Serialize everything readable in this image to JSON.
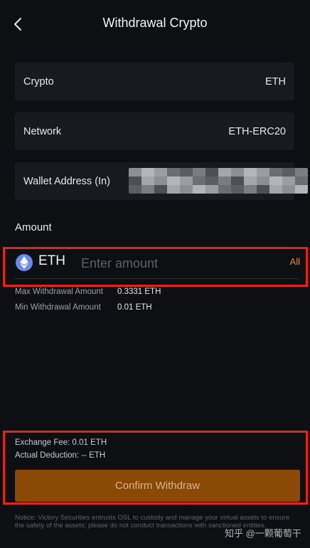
{
  "header": {
    "title": "Withdrawal Crypto"
  },
  "fields": {
    "crypto": {
      "label": "Crypto",
      "value": "ETH"
    },
    "network": {
      "label": "Network",
      "value": "ETH-ERC20"
    },
    "wallet": {
      "label": "Wallet Address (In)"
    }
  },
  "amount": {
    "section_title": "Amount",
    "currency": "ETH",
    "placeholder": "Enter amount",
    "all_label": "All"
  },
  "limits": {
    "max_label": "Max Withdrawal Amount",
    "max_value": "0.3331 ETH",
    "min_label": "Min Withdrawal Amount",
    "min_value": "0.01 ETH"
  },
  "fees": {
    "exchange_fee": "Exchange Fee: 0.01 ETH",
    "actual_deduction": "Actual Deduction: -- ETH"
  },
  "confirm_label": "Confirm Withdraw",
  "notice": "Notice: Victory Securities entrusts OSL to custody and manage your virtual assets to ensure the safety of the assets; please do not conduct transactions with sanctioned entities.",
  "watermark": "知乎 @一颗葡萄干",
  "colors": {
    "accent": "#ef8a1e",
    "confirm_bg": "#8a4a05",
    "highlight": "#e0261b",
    "eth_icon": "#6b8ae6"
  },
  "icons": {
    "back": "chevron-left-icon",
    "currency": "ethereum-icon"
  }
}
